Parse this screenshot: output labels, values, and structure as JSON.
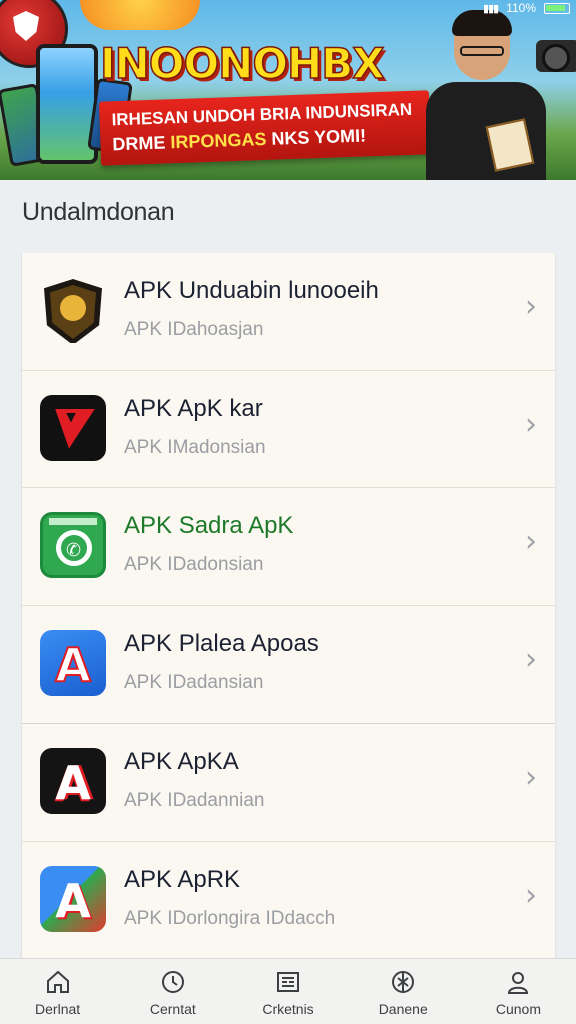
{
  "status": {
    "battery_text": "110%"
  },
  "banner": {
    "headline": "INOONOHBX",
    "line1": "IRHESAN UNDOH BRIA INDUNSIRAN",
    "line2_a": "DRME ",
    "line2_b": "IRPONGAS",
    "line2_c": " NKS YOMI!"
  },
  "section_title": "Undalmdonan",
  "apps": [
    {
      "title": "APK Unduabin lunooeih",
      "subtitle": "APK IDahoasjan",
      "icon": "shield-emblem-icon",
      "title_color": "#1c2233"
    },
    {
      "title": "APK ApK kar",
      "subtitle": "APK IMadonsian",
      "icon": "red-triangle-app-icon",
      "title_color": "#1c2233"
    },
    {
      "title": "APK Sadra ApK",
      "subtitle": "APK IDadonsian",
      "icon": "phone-call-app-icon",
      "title_color": "#1e7a2a"
    },
    {
      "title": "APK Plalea Apoas",
      "subtitle": "APK IDadansian",
      "icon": "app-store-a-icon",
      "title_color": "#1c2233"
    },
    {
      "title": "APK ApKA",
      "subtitle": "APK IDadannian",
      "icon": "black-a-app-icon",
      "title_color": "#1c2233"
    },
    {
      "title": "APK ApRK",
      "subtitle": "APK IDorlongira IDdacch",
      "icon": "multicolor-a-app-icon",
      "title_color": "#1c2233"
    }
  ],
  "nav": [
    {
      "label": "Derlnat",
      "icon": "home-icon"
    },
    {
      "label": "Cerntat",
      "icon": "clock-icon"
    },
    {
      "label": "Crketnis",
      "icon": "document-icon"
    },
    {
      "label": "Danene",
      "icon": "globe-icon"
    },
    {
      "label": "Cunom",
      "icon": "profile-icon"
    }
  ]
}
